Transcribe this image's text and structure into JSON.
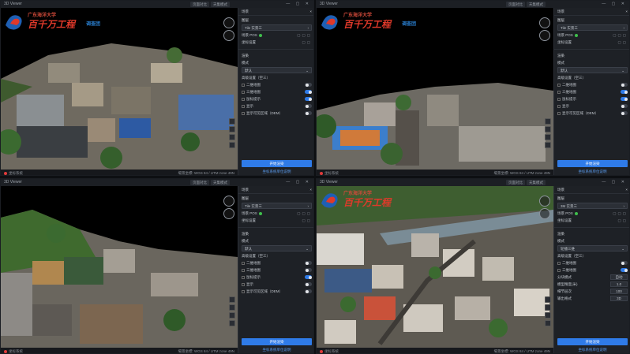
{
  "window_title": "3D Viewer",
  "title_tabs": [
    "页面对比",
    "天集模式"
  ],
  "window_controls": "— ▢ ✕",
  "logo": {
    "school": "广东海洋大学",
    "slogan": "百千万工程",
    "suffix": "调查团"
  },
  "colors": {
    "accent": "#2f7be8",
    "panel_bg": "#1e2126",
    "slogan_red": "#e0392a",
    "ok_green": "#3fbf4c"
  },
  "panel": {
    "header": "场景",
    "close": "×",
    "layer_section": "图层",
    "layer_select": "Tile 实景三",
    "pos_label": "场景 POS",
    "unit_label": "坐标设置",
    "render_section": "渲染",
    "mode_label": "模式",
    "mode_value": "默认",
    "options_header": "高级设置（空三）",
    "opt1": "二维地图",
    "opt2": "三维地图",
    "opt3": "鼠标提示",
    "opt4": "显示",
    "opt5": "显示可见区域（DEM）",
    "primary_button": "开始渲染",
    "link": "坐标系统单位说明"
  },
  "panel_q4": {
    "layer_select": "3M 实景三",
    "mode_value": "轮播三维",
    "options_header": "高级设置（空三）",
    "opt1": "二维地图",
    "opt2": "三维地图",
    "field1_label": "分块模式",
    "field1_value": "自动",
    "field2_label": "模型精度(米)",
    "field2_value": "1.0",
    "field3_label": "细节层次",
    "field3_value": "100",
    "field4_label": "输出格式",
    "field4_value": "3D"
  },
  "status": {
    "left": "坐标系统",
    "right": "場景坐標: WGS 84 / UTM zone 49N"
  },
  "views": [
    {
      "toggles": [
        false,
        true,
        true,
        false,
        false
      ]
    },
    {
      "toggles": [
        false,
        true,
        true,
        false,
        false
      ]
    },
    {
      "toggles": [
        false,
        false,
        true,
        false,
        false
      ]
    },
    {
      "toggles": [
        false,
        true
      ]
    }
  ]
}
